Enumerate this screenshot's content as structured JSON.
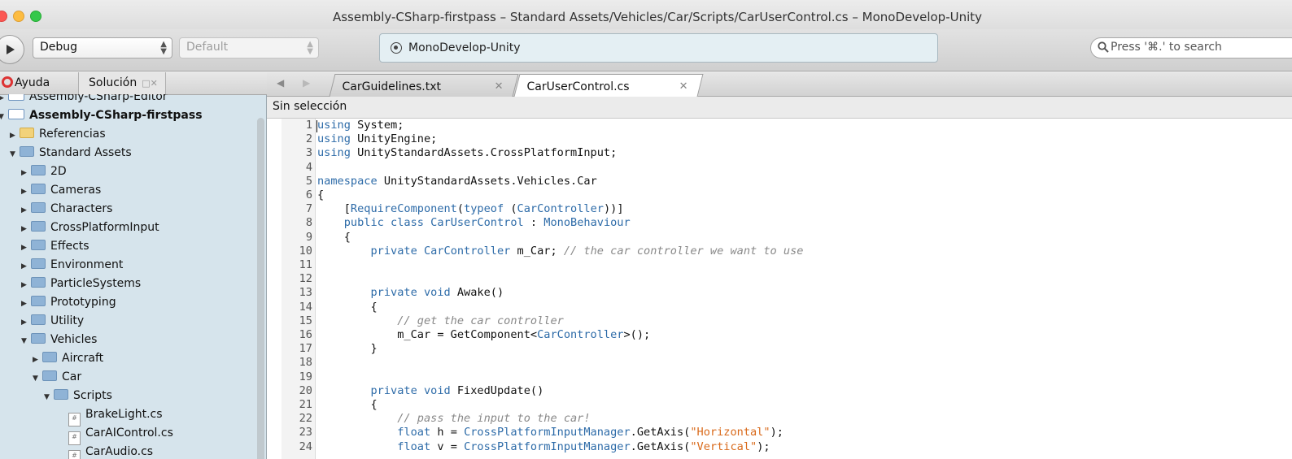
{
  "window": {
    "title": "Assembly-CSharp-firstpass – Standard Assets/Vehicles/Car/Scripts/CarUserControl.cs – MonoDevelop-Unity"
  },
  "toolbar": {
    "configuration": "Debug",
    "platform": "Default",
    "status_text": "MonoDevelop-Unity",
    "search_placeholder": "Press '⌘.' to search"
  },
  "pads": {
    "tabs": [
      {
        "label": "Ayuda",
        "icon": "lifebuoy-icon"
      },
      {
        "label": "Solución",
        "icon": "folder-icon"
      }
    ]
  },
  "solution_tree": [
    {
      "label": "Assembly-CSharp-Editor",
      "depth": 0,
      "expanded": false,
      "kind": "project",
      "bold": false
    },
    {
      "label": "Assembly-CSharp-firstpass",
      "depth": 0,
      "expanded": true,
      "kind": "project",
      "bold": true
    },
    {
      "label": "Referencias",
      "depth": 1,
      "expanded": false,
      "kind": "references",
      "bold": false
    },
    {
      "label": "Standard Assets",
      "depth": 1,
      "expanded": true,
      "kind": "folder",
      "bold": false
    },
    {
      "label": "2D",
      "depth": 2,
      "expanded": false,
      "kind": "folder",
      "bold": false
    },
    {
      "label": "Cameras",
      "depth": 2,
      "expanded": false,
      "kind": "folder",
      "bold": false
    },
    {
      "label": "Characters",
      "depth": 2,
      "expanded": false,
      "kind": "folder",
      "bold": false
    },
    {
      "label": "CrossPlatformInput",
      "depth": 2,
      "expanded": false,
      "kind": "folder",
      "bold": false
    },
    {
      "label": "Effects",
      "depth": 2,
      "expanded": false,
      "kind": "folder",
      "bold": false
    },
    {
      "label": "Environment",
      "depth": 2,
      "expanded": false,
      "kind": "folder",
      "bold": false
    },
    {
      "label": "ParticleSystems",
      "depth": 2,
      "expanded": false,
      "kind": "folder",
      "bold": false
    },
    {
      "label": "Prototyping",
      "depth": 2,
      "expanded": false,
      "kind": "folder",
      "bold": false
    },
    {
      "label": "Utility",
      "depth": 2,
      "expanded": false,
      "kind": "folder",
      "bold": false
    },
    {
      "label": "Vehicles",
      "depth": 2,
      "expanded": true,
      "kind": "folder",
      "bold": false
    },
    {
      "label": "Aircraft",
      "depth": 3,
      "expanded": false,
      "kind": "folder",
      "bold": false
    },
    {
      "label": "Car",
      "depth": 3,
      "expanded": true,
      "kind": "folder",
      "bold": false
    },
    {
      "label": "Scripts",
      "depth": 4,
      "expanded": true,
      "kind": "folder",
      "bold": false
    },
    {
      "label": "BrakeLight.cs",
      "depth": 5,
      "expanded": null,
      "kind": "file",
      "bold": false
    },
    {
      "label": "CarAIControl.cs",
      "depth": 5,
      "expanded": null,
      "kind": "file",
      "bold": false
    },
    {
      "label": "CarAudio.cs",
      "depth": 5,
      "expanded": null,
      "kind": "file",
      "bold": false
    }
  ],
  "editor": {
    "tabs": [
      {
        "label": "CarGuidelines.txt",
        "active": false
      },
      {
        "label": "CarUserControl.cs",
        "active": true
      }
    ],
    "breadcrumb": "Sin selección",
    "lines": [
      {
        "n": "1",
        "tokens": [
          [
            "kw",
            "using"
          ],
          [
            "",
            "System;"
          ]
        ]
      },
      {
        "n": "2",
        "tokens": [
          [
            "kw",
            "using"
          ],
          [
            "",
            "UnityEngine;"
          ]
        ]
      },
      {
        "n": "3",
        "tokens": [
          [
            "kw",
            "using"
          ],
          [
            "",
            "UnityStandardAssets.CrossPlatformInput;"
          ]
        ]
      },
      {
        "n": "4",
        "tokens": []
      },
      {
        "n": "5",
        "tokens": [
          [
            "kw",
            "namespace"
          ],
          [
            "",
            "UnityStandardAssets.Vehicles.Car"
          ]
        ]
      },
      {
        "n": "6",
        "tokens": [
          [
            "",
            "{"
          ]
        ]
      },
      {
        "n": "7",
        "tokens": [
          [
            "",
            "    ["
          ],
          [
            "ty",
            "RequireComponent"
          ],
          [
            "",
            "("
          ],
          [
            "kw",
            "typeof"
          ],
          [
            "",
            " ("
          ],
          [
            "ty",
            "CarController"
          ],
          [
            "",
            "))]"
          ]
        ]
      },
      {
        "n": "8",
        "tokens": [
          [
            "kw",
            "    public class"
          ],
          [
            "",
            " "
          ],
          [
            "ty",
            "CarUserControl"
          ],
          [
            "",
            " : "
          ],
          [
            "ty",
            "MonoBehaviour"
          ]
        ]
      },
      {
        "n": "9",
        "tokens": [
          [
            "",
            "    {"
          ]
        ]
      },
      {
        "n": "10",
        "tokens": [
          [
            "kw",
            "        private"
          ],
          [
            "",
            " "
          ],
          [
            "ty",
            "CarController"
          ],
          [
            "",
            " m_Car; "
          ],
          [
            "cm",
            "// the car controller we want to use"
          ]
        ]
      },
      {
        "n": "11",
        "tokens": []
      },
      {
        "n": "12",
        "tokens": []
      },
      {
        "n": "13",
        "tokens": [
          [
            "kw",
            "        private void"
          ],
          [
            "",
            " Awake()"
          ]
        ]
      },
      {
        "n": "14",
        "tokens": [
          [
            "",
            "        {"
          ]
        ]
      },
      {
        "n": "15",
        "tokens": [
          [
            "cm",
            "            // get the car controller"
          ]
        ]
      },
      {
        "n": "16",
        "tokens": [
          [
            "",
            "            m_Car = GetComponent<"
          ],
          [
            "ty",
            "CarController"
          ],
          [
            "",
            ">();"
          ]
        ]
      },
      {
        "n": "17",
        "tokens": [
          [
            "",
            "        }"
          ]
        ]
      },
      {
        "n": "18",
        "tokens": []
      },
      {
        "n": "19",
        "tokens": []
      },
      {
        "n": "20",
        "tokens": [
          [
            "kw",
            "        private void"
          ],
          [
            "",
            " FixedUpdate()"
          ]
        ]
      },
      {
        "n": "21",
        "tokens": [
          [
            "",
            "        {"
          ]
        ]
      },
      {
        "n": "22",
        "tokens": [
          [
            "cm",
            "            // pass the input to the car!"
          ]
        ]
      },
      {
        "n": "23",
        "tokens": [
          [
            "kw",
            "            float"
          ],
          [
            "",
            " h = "
          ],
          [
            "ty",
            "CrossPlatformInputManager"
          ],
          [
            "",
            ".GetAxis("
          ],
          [
            "st",
            "\"Horizontal\""
          ],
          [
            "",
            ");"
          ]
        ]
      },
      {
        "n": "24",
        "tokens": [
          [
            "kw",
            "            float"
          ],
          [
            "",
            " v = "
          ],
          [
            "ty",
            "CrossPlatformInputManager"
          ],
          [
            "",
            ".GetAxis("
          ],
          [
            "st",
            "\"Vertical\""
          ],
          [
            "",
            ");"
          ]
        ]
      }
    ]
  },
  "colors": {
    "keyword": "#2d6ba8",
    "comment": "#888888",
    "string": "#d96a1b",
    "tree_background": "#d6e4ec"
  }
}
